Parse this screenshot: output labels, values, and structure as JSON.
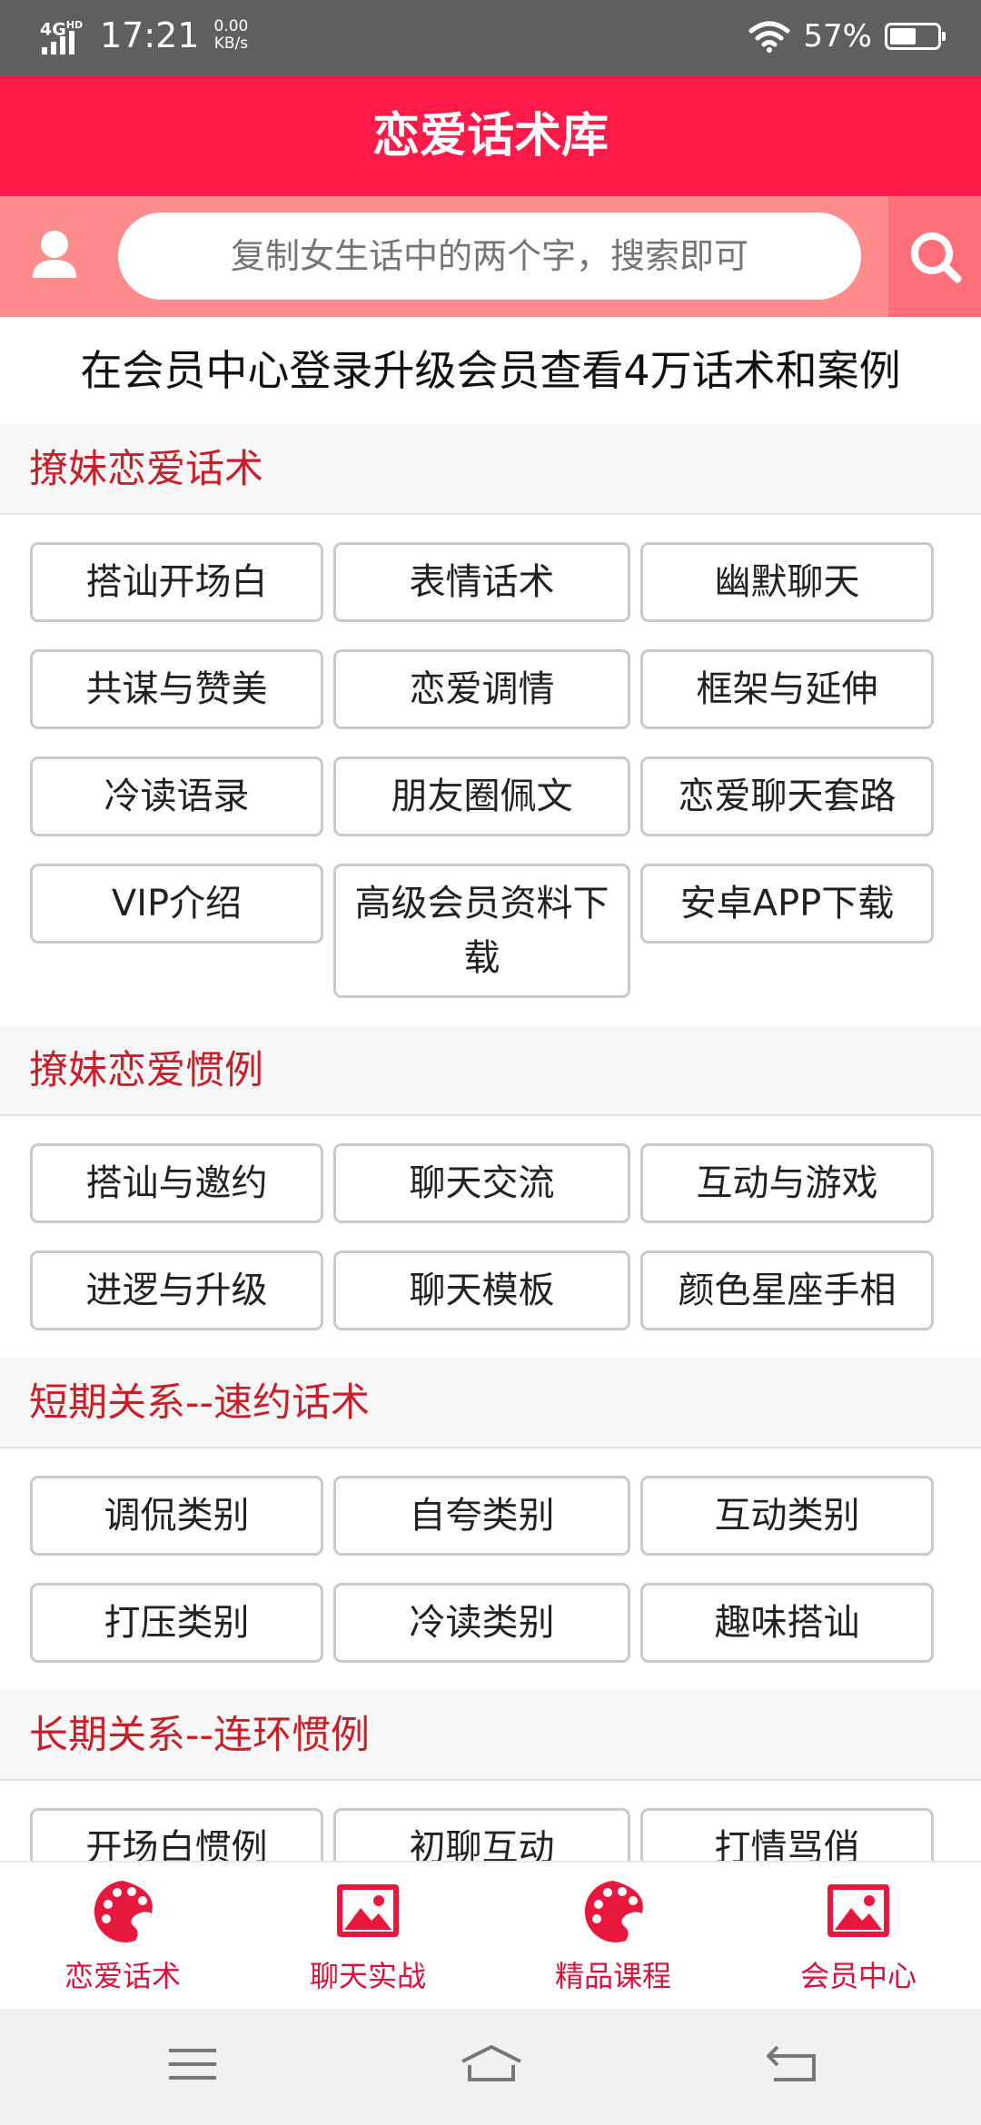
{
  "status_bar": {
    "network": "4G",
    "network_sup": "HD",
    "time": "17:21",
    "speed_value": "0.00",
    "speed_unit": "KB/s",
    "battery_percent": "57%",
    "battery_level": 0.57
  },
  "header": {
    "title": "恋爱话术库"
  },
  "search": {
    "placeholder": "复制女生话中的两个字，搜索即可"
  },
  "notice": "在会员中心登录升级会员查看4万话术和案例",
  "sections": [
    {
      "title": "撩妹恋爱话术",
      "items": [
        "搭讪开场白",
        "表情话术",
        "幽默聊天",
        "共谋与赞美",
        "恋爱调情",
        "框架与延伸",
        "冷读语录",
        "朋友圈佩文",
        "恋爱聊天套路",
        "VIP介绍",
        "高级会员资料下载",
        "安卓APP下载"
      ]
    },
    {
      "title": "撩妹恋爱惯例",
      "items": [
        "搭讪与邀约",
        "聊天交流",
        "互动与游戏",
        "进逻与升级",
        "聊天模板",
        "颜色星座手相"
      ]
    },
    {
      "title": "短期关系--速约话术",
      "items": [
        "调侃类别",
        "自夸类别",
        "互动类别",
        "打压类别",
        "冷读类别",
        "趣味搭讪"
      ]
    },
    {
      "title": "长期关系--连环惯例",
      "items": [
        "开场白惯例",
        "初聊互动",
        "打情骂俏"
      ]
    }
  ],
  "tabs": [
    {
      "label": "恋爱话术",
      "icon": "palette-icon"
    },
    {
      "label": "聊天实战",
      "icon": "image-icon"
    },
    {
      "label": "精品课程",
      "icon": "palette-icon"
    },
    {
      "label": "会员中心",
      "icon": "image-icon"
    }
  ],
  "colors": {
    "accent": "#ff1a4a",
    "search_bg": "#ff8c8c",
    "section_title": "#c81f28",
    "tab_label": "#d8123a"
  }
}
